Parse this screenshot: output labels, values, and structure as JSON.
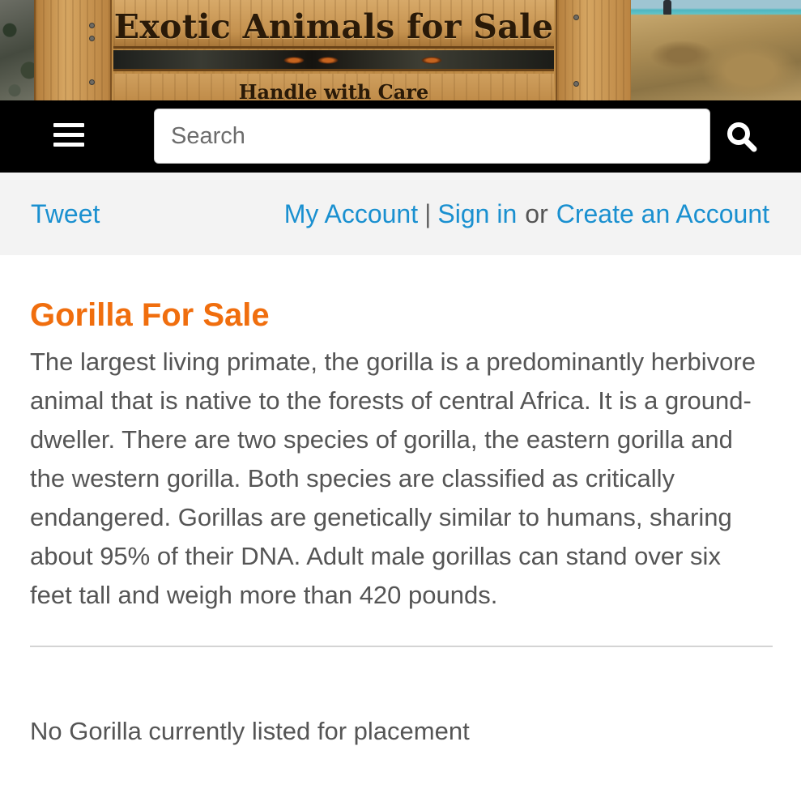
{
  "banner": {
    "title": "Exotic Animals for Sale",
    "subtitle": "Handle with Care"
  },
  "navbar": {
    "search_placeholder": "Search",
    "menu_icon": "hamburger-menu-icon",
    "search_icon": "magnifier-icon"
  },
  "account_bar": {
    "tweet_label": "Tweet",
    "my_account_label": "My Account",
    "separator": "|",
    "sign_in_label": "Sign in",
    "or_text": "or",
    "create_account_label": "Create an Account"
  },
  "main": {
    "title": "Gorilla For Sale",
    "description": "The largest living primate, the gorilla is a predominantly herbivore animal that is native to the forests of central Africa. It is a ground-dweller. There are two species of gorilla, the eastern gorilla and the western gorilla. Both species are classified as critically endangered. Gorillas are genetically similar to humans, sharing about 95% of their DNA. Adult male gorillas can stand over six feet tall and weigh more than 420 pounds.",
    "empty_listing_text": "No Gorilla currently listed for placement"
  },
  "colors": {
    "accent_orange": "#f06e0e",
    "link_blue": "#1a90d0",
    "navbar_bg": "#000000",
    "account_bar_bg": "#f3f3f3",
    "body_text": "#555555"
  }
}
